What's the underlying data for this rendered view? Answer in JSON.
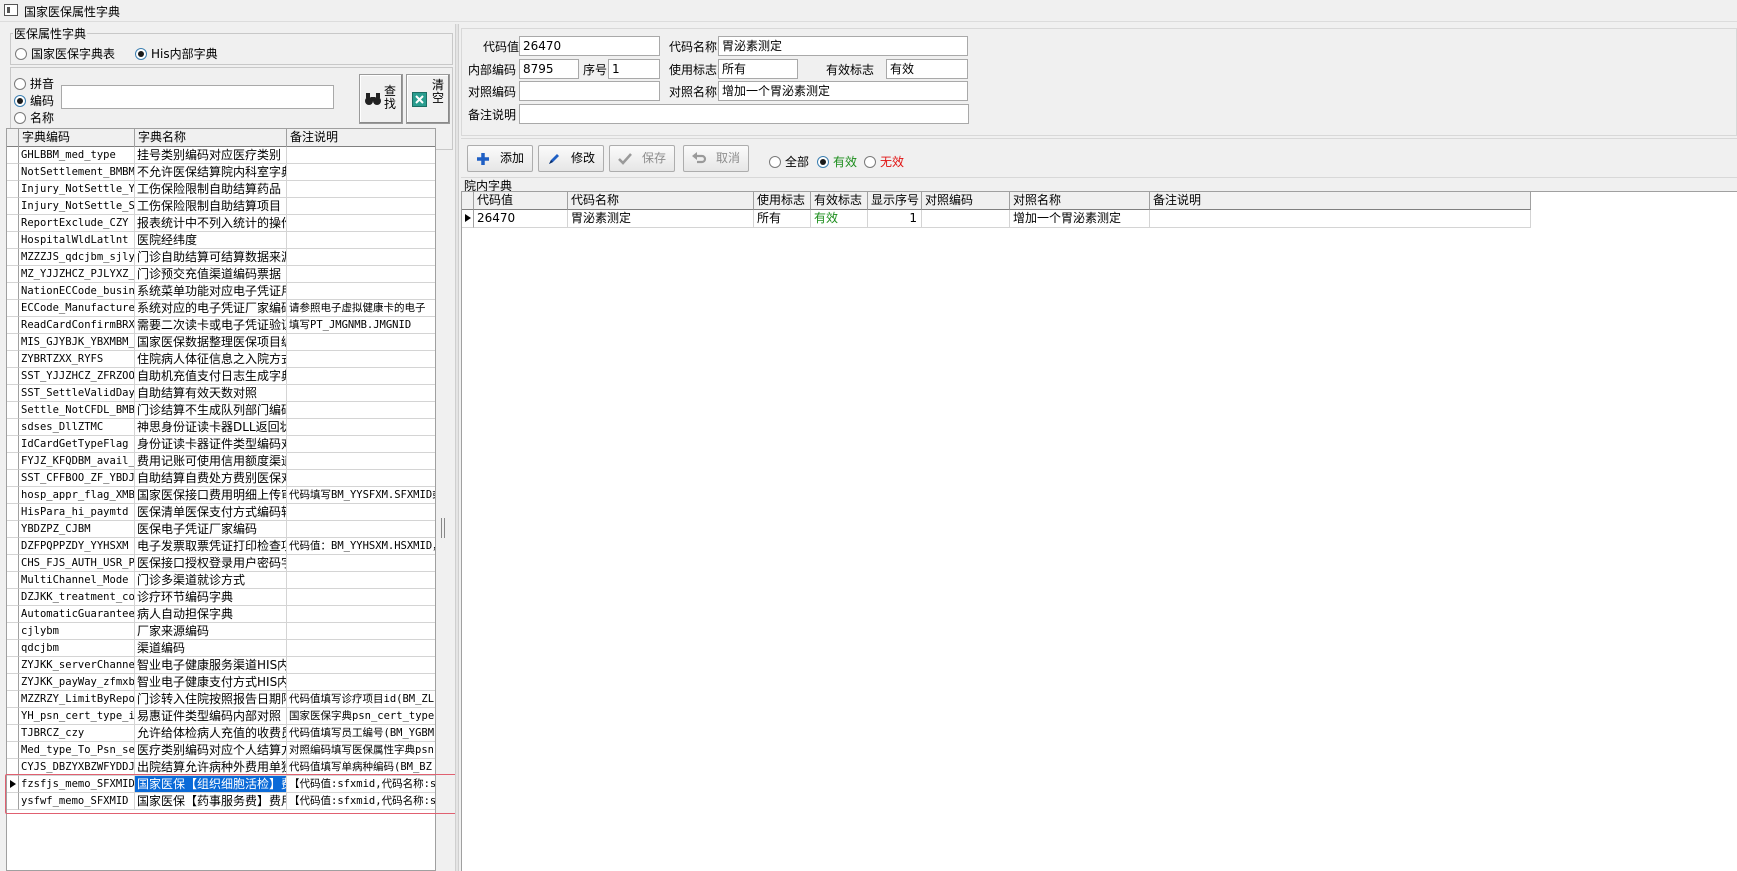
{
  "window": {
    "title": "国家医保属性字典"
  },
  "left": {
    "group_title": "医保属性字典",
    "source_radios": [
      {
        "label": "国家医保字典表",
        "checked": false
      },
      {
        "label": "His内部字典",
        "checked": true
      }
    ],
    "search_mode_radios": [
      {
        "label": "拼音",
        "checked": false
      },
      {
        "label": "编码",
        "checked": true
      },
      {
        "label": "名称",
        "checked": false
      }
    ],
    "search_value": "",
    "find_button": "查找",
    "clear_button": "清空",
    "grid": {
      "columns": [
        "字典编码",
        "字典名称",
        "备注说明"
      ],
      "rows": [
        [
          "GHLBBM_med_type",
          "挂号类别编码对应医疗类别",
          ""
        ],
        [
          "NotSettlement_BMBM",
          "不允许医保结算院内科室字典",
          ""
        ],
        [
          "Injury_NotSettle_YP",
          "工伤保险限制自助结算药品",
          ""
        ],
        [
          "Injury_NotSettle_SF",
          "工伤保险限制自助结算项目",
          ""
        ],
        [
          "ReportExclude_CZY",
          "报表统计中不列入统计的操作员",
          ""
        ],
        [
          "HospitalWldLatlnt",
          "医院经纬度",
          ""
        ],
        [
          "MZZZJS_qdcjbm_sjly",
          "门诊自助结算可结算数据来源",
          ""
        ],
        [
          "MZ_YJJZHCZ_PJLYXZ_",
          "门诊预交充值渠道编码票据",
          ""
        ],
        [
          "NationECCode_business",
          "系统菜单功能对应电子凭证用码",
          ""
        ],
        [
          "ECCode_Manufacture",
          "系统对应的电子凭证厂家编码",
          "请参照电子虚拟健康卡的电子"
        ],
        [
          "ReadCardConfirmBRXX",
          "需要二次读卡或电子凭证验证",
          "填写PT_JMGNMB.JMGNID"
        ],
        [
          "MIS_GJYBJK_YBXMBM_",
          "国家医保数据整理医保项目编码",
          ""
        ],
        [
          "ZYBRTZXX_RYFS",
          "住院病人体征信息之入院方式",
          ""
        ],
        [
          "SST_YJJZHCZ_ZFRZOO",
          "自助机充值支付日志生成字典",
          ""
        ],
        [
          "SST_SettleValidDay",
          "自助结算有效天数对照",
          ""
        ],
        [
          "Settle_NotCFDL_BMB",
          "门诊结算不生成队列部门编码",
          ""
        ],
        [
          "sdses_DllZTMC",
          "神思身份证读卡器DLL返回状态",
          ""
        ],
        [
          "IdCardGetTypeFlag",
          "身份证读卡器证件类型编码对照",
          ""
        ],
        [
          "FYJZ_KFQDBM_avail_",
          "费用记账可使用信用额度渠道",
          ""
        ],
        [
          "SST_CFFBOO_ZF_YBDJ",
          "自助结算自费处方费别医保对照",
          ""
        ],
        [
          "hosp_appr_flag_XMB",
          "国家医保接口费用明细上传审批",
          "代码填写BM_YYSFXM.SFXMID或"
        ],
        [
          "HisPara_hi_paymtd",
          "医保清单医保支付方式编码转换",
          ""
        ],
        [
          "YBDZPZ_CJBM",
          "医保电子凭证厂家编码",
          ""
        ],
        [
          "DZFPQPPZDY_YYHSXM",
          "电子发票取票凭证打印检查项目",
          "代码值：BM_YYHSXM.HSXMID，"
        ],
        [
          "CHS_FJS_AUTH_USR_P",
          "医保接口授权登录用户密码字典",
          ""
        ],
        [
          "MultiChannel_Mode",
          "门诊多渠道就诊方式",
          ""
        ],
        [
          "DZJKK_treatment_code",
          "诊疗环节编码字典",
          ""
        ],
        [
          "AutomaticGuarantee",
          "病人自动担保字典",
          ""
        ],
        [
          "cjlybm",
          "厂家来源编码",
          ""
        ],
        [
          "qdcjbm",
          "渠道编码",
          ""
        ],
        [
          "ZYJKK_serverChannel",
          "智业电子健康服务渠道HIS内部",
          ""
        ],
        [
          "ZYJKK_payWay_zfmxb",
          "智业电子健康支付方式HIS内部",
          ""
        ],
        [
          "MZZRZY_LimitByReport",
          "门诊转入住院按照报告日期限制",
          "代码值填写诊疗项目id(BM_ZL"
        ],
        [
          "YH_psn_cert_type_in",
          "易惠证件类型编码内部对照",
          "国家医保字典psn_cert_type"
        ],
        [
          "TJBRCZ_czy",
          "允许给体检病人充值的收费员",
          "代码值填写员工编号(BM_YGBM"
        ],
        [
          "Med_type_To_Psn_set",
          "医疗类别编码对应个人结算方式",
          "对照编码填写医保属性字典psn"
        ],
        [
          "CYJS_DBZYXBZWFYDDJ",
          "出院结算允许病种外费用单独",
          "代码值填写单病种编码(BM_BZ"
        ],
        [
          "fzsfjs_memo_SFXMID",
          "国家医保【组织细胞活检】费用",
          "【代码值:sfxmid,代码名称:sfxm"
        ],
        [
          "ysfwf_memo_SFXMID",
          "国家医保【药事服务费】费用",
          "【代码值:sfxmid,代码名称:sfxm"
        ]
      ]
    }
  },
  "form": {
    "code_label": "代码值",
    "code_value": "26470",
    "name_label": "代码名称",
    "name_value": "胃泌素测定",
    "inner_code_label": "内部编码",
    "inner_code_value": "8795",
    "seq_label": "序号",
    "seq_value": "1",
    "use_flag_label": "使用标志",
    "use_flag_value": "所有",
    "valid_flag_label": "有效标志",
    "valid_flag_value": "有效",
    "map_code_label": "对照编码",
    "map_code_value": "",
    "map_name_label": "对照名称",
    "map_name_value": "增加一个胃泌素测定",
    "remark_label": "备注说明",
    "remark_value": ""
  },
  "toolbar": {
    "add": "添加",
    "edit": "修改",
    "save": "保存",
    "cancel": "取消",
    "filters": [
      {
        "label": "全部",
        "checked": false,
        "color": "#000000"
      },
      {
        "label": "有效",
        "checked": true,
        "color": "#1a8c1a"
      },
      {
        "label": "无效",
        "checked": false,
        "color": "#e01010"
      }
    ]
  },
  "inner": {
    "title": "院内字典",
    "columns": [
      "代码值",
      "代码名称",
      "使用标志",
      "有效标志",
      "显示序号",
      "对照编码",
      "对照名称",
      "备注说明"
    ],
    "rows": [
      [
        "26470",
        "胃泌素测定",
        "所有",
        "有效",
        "1",
        "",
        "增加一个胃泌素测定",
        ""
      ]
    ]
  }
}
